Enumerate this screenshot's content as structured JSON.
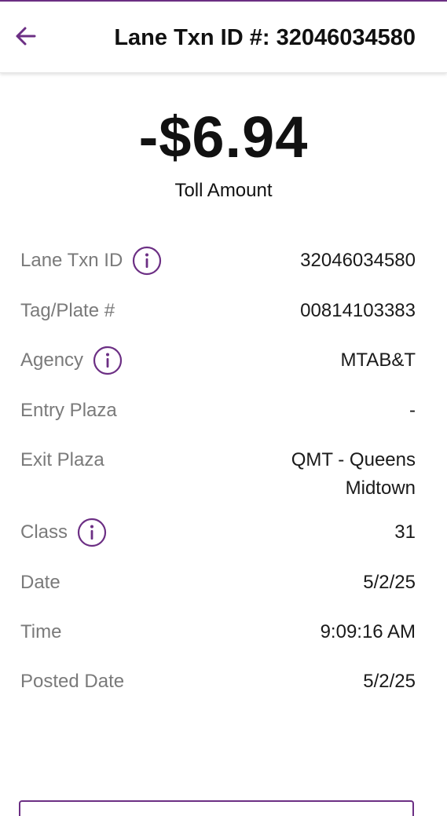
{
  "header": {
    "title": "Lane Txn ID #: 32046034580",
    "back_icon": "arrow-left-icon",
    "accent_color": "#6c2f84"
  },
  "summary": {
    "amount": "-$6.94",
    "amount_label": "Toll Amount"
  },
  "details": {
    "lane_txn_id": {
      "label": "Lane Txn ID",
      "value": "32046034580"
    },
    "tag_plate": {
      "label": "Tag/Plate #",
      "value": "00814103383"
    },
    "agency": {
      "label": "Agency",
      "value": "MTAB&T"
    },
    "entry_plaza": {
      "label": "Entry Plaza",
      "value": "-"
    },
    "exit_plaza": {
      "label": "Exit Plaza",
      "value": "QMT - Queens\nMidtown"
    },
    "class": {
      "label": "Class",
      "value": "31"
    },
    "date": {
      "label": "Date",
      "value": "5/2/25"
    },
    "time": {
      "label": "Time",
      "value": "9:09:16 AM"
    },
    "posted_date": {
      "label": "Posted Date",
      "value": "5/2/25"
    }
  }
}
